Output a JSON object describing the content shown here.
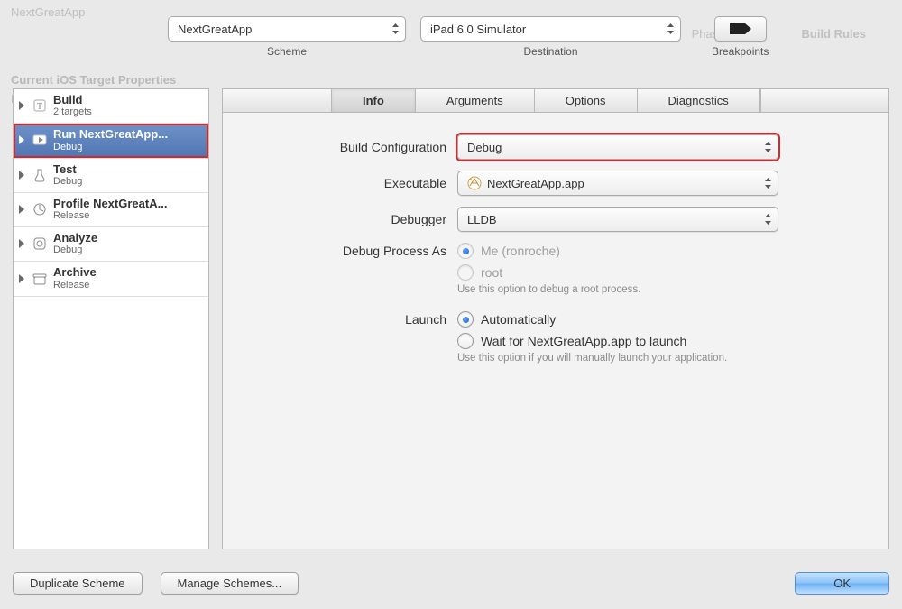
{
  "bg": {
    "title_fragment": "NextGreatApp",
    "faded1": "Current iOS Target Properties",
    "faded2": "Key",
    "faded_right1": "Build Rules",
    "faded_right2": "Phases"
  },
  "toolbar": {
    "scheme": {
      "value": "NextGreatApp",
      "caption": "Scheme"
    },
    "destination": {
      "value": "iPad 6.0 Simulator",
      "caption": "Destination"
    },
    "breakpoints": {
      "caption": "Breakpoints"
    }
  },
  "sidebar": {
    "items": [
      {
        "title": "Build",
        "subtitle": "2 targets",
        "icon": "build"
      },
      {
        "title": "Run NextGreatApp...",
        "subtitle": "Debug",
        "icon": "run",
        "selected": true
      },
      {
        "title": "Test",
        "subtitle": "Debug",
        "icon": "test"
      },
      {
        "title": "Profile NextGreatA...",
        "subtitle": "Release",
        "icon": "profile"
      },
      {
        "title": "Analyze",
        "subtitle": "Debug",
        "icon": "analyze"
      },
      {
        "title": "Archive",
        "subtitle": "Release",
        "icon": "archive"
      }
    ]
  },
  "tabs": {
    "items": [
      "Info",
      "Arguments",
      "Options",
      "Diagnostics"
    ],
    "active": "Info"
  },
  "form": {
    "build_configuration": {
      "label": "Build Configuration",
      "value": "Debug"
    },
    "executable": {
      "label": "Executable",
      "value": "NextGreatApp.app"
    },
    "debugger": {
      "label": "Debugger",
      "value": "LLDB"
    },
    "debug_process_as": {
      "label": "Debug Process As",
      "option_me": "Me (ronroche)",
      "option_root": "root",
      "root_hint": "Use this option to debug a root process."
    },
    "launch": {
      "label": "Launch",
      "option_auto": "Automatically",
      "option_wait": "Wait for NextGreatApp.app to launch",
      "wait_hint": "Use this option if you will manually launch your application."
    }
  },
  "buttons": {
    "duplicate": "Duplicate Scheme",
    "manage": "Manage Schemes...",
    "ok": "OK"
  }
}
